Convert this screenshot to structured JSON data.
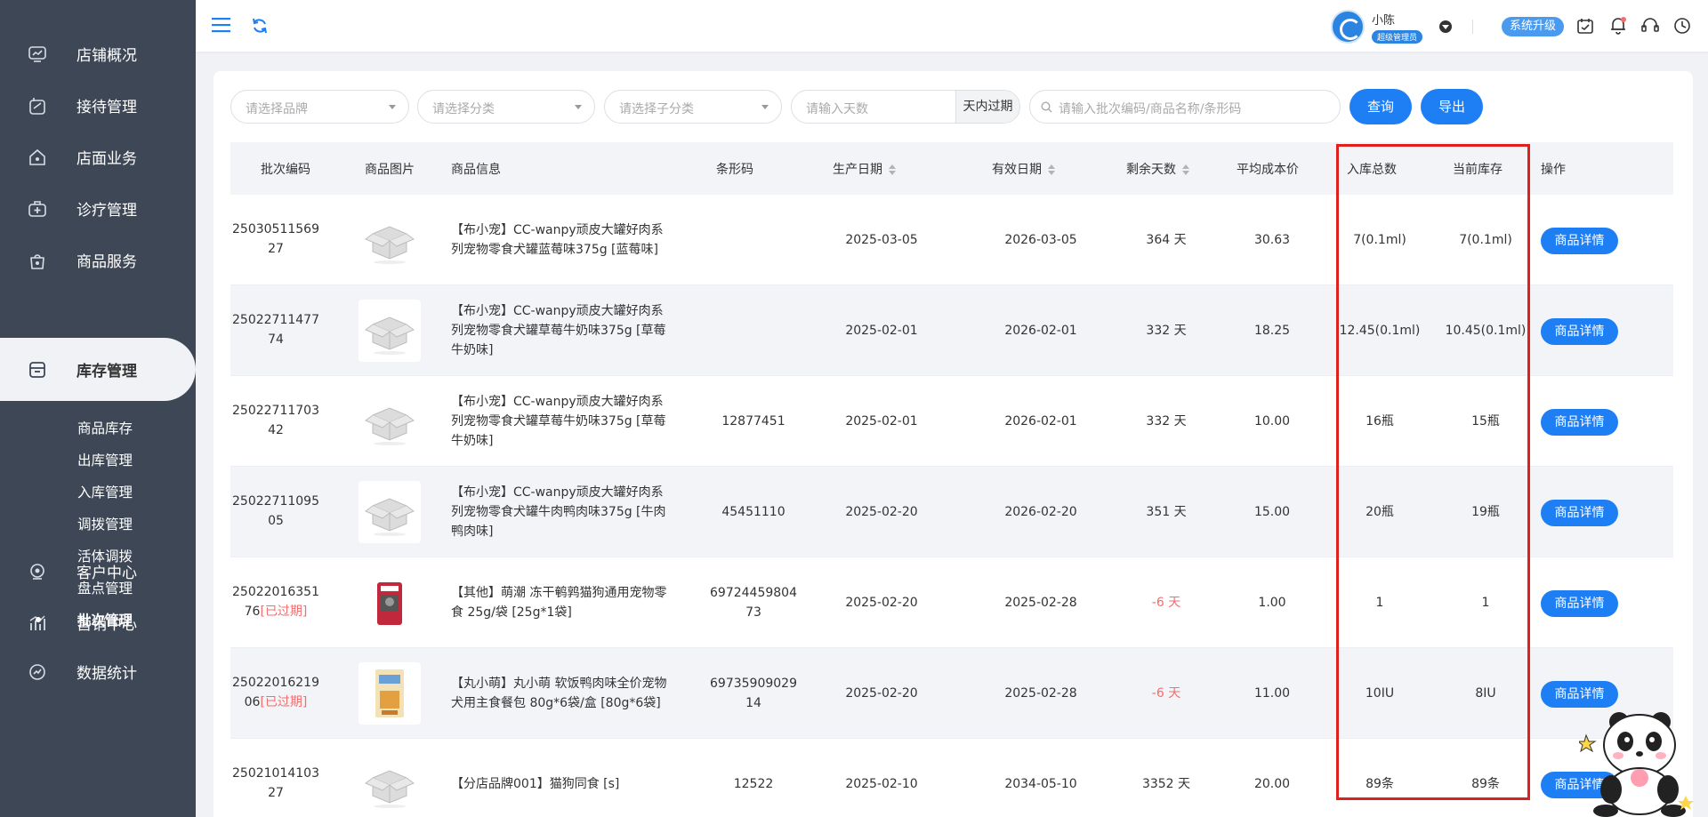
{
  "sidebar": {
    "items": [
      {
        "label": "店铺概况",
        "icon": "dashboard-icon"
      },
      {
        "label": "接待管理",
        "icon": "reception-icon"
      },
      {
        "label": "店面业务",
        "icon": "store-icon"
      },
      {
        "label": "诊疗管理",
        "icon": "medical-icon"
      },
      {
        "label": "商品服务",
        "icon": "bag-icon"
      },
      {
        "label": "库存管理",
        "icon": "inventory-icon"
      },
      {
        "label": "客户中心",
        "icon": "customer-icon"
      },
      {
        "label": "营销中心",
        "icon": "marketing-icon"
      },
      {
        "label": "数据统计",
        "icon": "stats-icon"
      }
    ],
    "active": "库存管理",
    "sub_items": [
      "商品库存",
      "出库管理",
      "入库管理",
      "调拨管理",
      "活体调拨",
      "盘点管理",
      "批次管理"
    ],
    "active_sub": "批次管理"
  },
  "header": {
    "user_name": "小陈",
    "user_role": "超级管理员",
    "upgrade_label": "系统升级"
  },
  "filters": {
    "brand_placeholder": "请选择品牌",
    "category_placeholder": "请选择分类",
    "subcategory_placeholder": "请选择子分类",
    "days_placeholder": "请输入天数",
    "days_suffix": "天内过期",
    "search_placeholder": "请输入批次编码/商品名称/条形码",
    "query_label": "查询",
    "export_label": "导出"
  },
  "table": {
    "headers": {
      "batch": "批次编码",
      "image": "商品图片",
      "info": "商品信息",
      "barcode": "条形码",
      "prod_date": "生产日期",
      "exp_date": "有效日期",
      "remaining": "剩余天数",
      "avg_cost": "平均成本价",
      "in_total": "入库总数",
      "current": "当前库存",
      "ops": "操作"
    },
    "detail_label": "商品详情",
    "expired_label": "[已过期]",
    "rows": [
      {
        "batch1": "25030511569",
        "batch2": "27",
        "expired": false,
        "img": "box",
        "info1": "【布小宠】CC-wanpy顽皮大罐好肉系",
        "info2": "列宠物零食犬罐蓝莓味375g [蓝莓味]",
        "info3": "",
        "barcode1": "",
        "barcode2": "",
        "prod": "2025-03-05",
        "exp": "2026-03-05",
        "remaining": "364 天",
        "neg": false,
        "cost": "30.63",
        "in_total": "7(0.1ml)",
        "current": "7(0.1ml)"
      },
      {
        "batch1": "25022711477",
        "batch2": "74",
        "expired": false,
        "img": "box",
        "info1": "【布小宠】CC-wanpy顽皮大罐好肉系",
        "info2": "列宠物零食犬罐草莓牛奶味375g [草莓",
        "info3": "牛奶味]",
        "barcode1": "",
        "barcode2": "",
        "prod": "2025-02-01",
        "exp": "2026-02-01",
        "remaining": "332 天",
        "neg": false,
        "cost": "18.25",
        "in_total": "12.45(0.1ml)",
        "current": "10.45(0.1ml)"
      },
      {
        "batch1": "25022711703",
        "batch2": "42",
        "expired": false,
        "img": "box",
        "info1": "【布小宠】CC-wanpy顽皮大罐好肉系",
        "info2": "列宠物零食犬罐草莓牛奶味375g [草莓",
        "info3": "牛奶味]",
        "barcode1": "12877451",
        "barcode2": "",
        "prod": "2025-02-01",
        "exp": "2026-02-01",
        "remaining": "332 天",
        "neg": false,
        "cost": "10.00",
        "in_total": "16瓶",
        "current": "15瓶"
      },
      {
        "batch1": "25022711095",
        "batch2": "05",
        "expired": false,
        "img": "box",
        "info1": "【布小宠】CC-wanpy顽皮大罐好肉系",
        "info2": "列宠物零食犬罐牛肉鸭肉味375g [牛肉",
        "info3": "鸭肉味]",
        "barcode1": "45451110",
        "barcode2": "",
        "prod": "2025-02-20",
        "exp": "2026-02-20",
        "remaining": "351 天",
        "neg": false,
        "cost": "15.00",
        "in_total": "20瓶",
        "current": "19瓶"
      },
      {
        "batch1": "25022016351",
        "batch2": "76",
        "expired": true,
        "img": "snack",
        "info1": "【其他】萌潮 冻干鹌鹑猫狗通用宠物零",
        "info2": "食 25g/袋 [25g*1袋]",
        "info3": "",
        "barcode1": "69724459804",
        "barcode2": "73",
        "prod": "2025-02-20",
        "exp": "2025-02-28",
        "remaining": "-6 天",
        "neg": true,
        "cost": "1.00",
        "in_total": "1",
        "current": "1"
      },
      {
        "batch1": "25022016219",
        "batch2": "06",
        "expired": true,
        "img": "pouch",
        "info1": "【丸小萌】丸小萌 软饭鸭肉味全价宠物",
        "info2": "犬用主食餐包 80g*6袋/盒 [80g*6袋]",
        "info3": "",
        "barcode1": "69735909029",
        "barcode2": "14",
        "prod": "2025-02-20",
        "exp": "2025-02-28",
        "remaining": "-6 天",
        "neg": true,
        "cost": "11.00",
        "in_total": "10IU",
        "current": "8IU"
      },
      {
        "batch1": "25021014103",
        "batch2": "27",
        "expired": false,
        "img": "box",
        "info1": "【分店品牌001】猫狗同食 [s]",
        "info2": "",
        "info3": "",
        "barcode1": "12522",
        "barcode2": "",
        "prod": "2025-02-10",
        "exp": "2034-05-10",
        "remaining": "3352 天",
        "neg": false,
        "cost": "20.00",
        "in_total": "89条",
        "current": "89条"
      }
    ]
  },
  "colors": {
    "sidebar_bg": "#3d4756",
    "primary": "#1e7ff5",
    "highlight_border": "#e0201d",
    "expired": "#f56c6c"
  }
}
